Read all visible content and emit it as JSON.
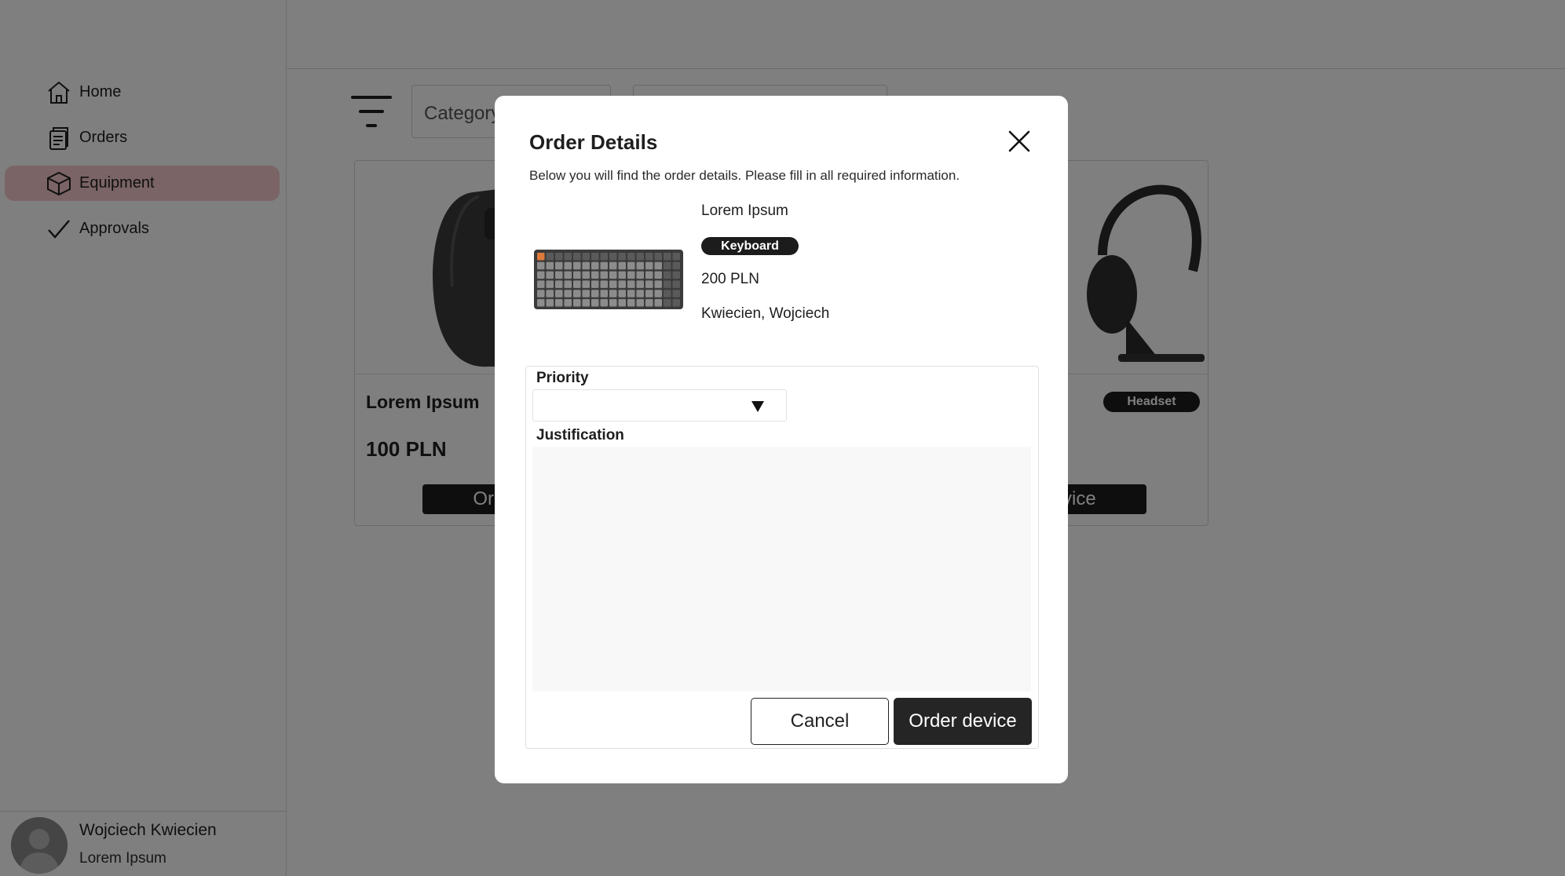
{
  "sidebar": {
    "items": [
      {
        "label": "Home",
        "icon": "home-icon"
      },
      {
        "label": "Orders",
        "icon": "clipboard-icon"
      },
      {
        "label": "Equipment",
        "icon": "box-icon",
        "active": true
      },
      {
        "label": "Approvals",
        "icon": "checkmark-icon"
      }
    ],
    "user": {
      "name": "Wojciech Kwiecien",
      "role": "Lorem Ipsum"
    }
  },
  "filters": {
    "category_label": "Category"
  },
  "cards": [
    {
      "title": "Lorem Ipsum",
      "price": "100 PLN",
      "button": "Order Device"
    },
    {
      "badge": "Headset",
      "button": "Order Device"
    }
  ],
  "modal": {
    "title": "Order Details",
    "description": "Below you will find the order details. Please fill in all required information.",
    "product": {
      "name": "Lorem Ipsum",
      "category": "Keyboard",
      "price": "200 PLN",
      "owner": "Kwiecien, Wojciech"
    },
    "form": {
      "priority_label": "Priority",
      "priority_value": "",
      "justification_label": "Justification",
      "justification_value": ""
    },
    "buttons": {
      "cancel": "Cancel",
      "order": "Order device"
    }
  },
  "colors": {
    "accent": "#f7c9cc",
    "dark": "#1c1c1c",
    "overlay": "rgba(0,0,0,0.5)"
  }
}
